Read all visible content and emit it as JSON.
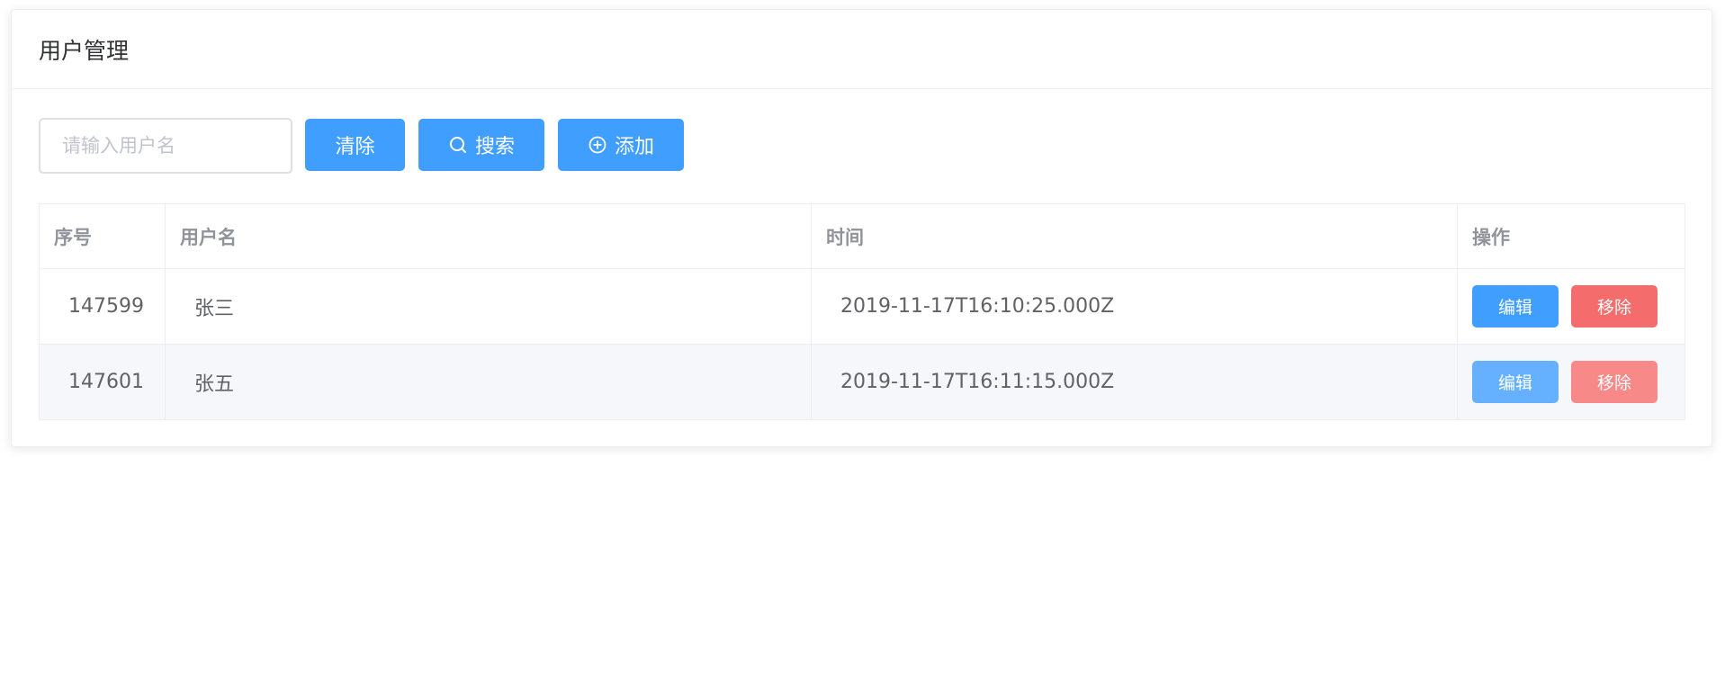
{
  "header": {
    "title": "用户管理"
  },
  "toolbar": {
    "search_placeholder": "请输入用户名",
    "clear_label": "清除",
    "search_label": "搜索",
    "add_label": "添加"
  },
  "table": {
    "columns": [
      "序号",
      "用户名",
      "时间",
      "操作"
    ],
    "rows": [
      {
        "id": "147599",
        "username": "张三",
        "time": "2019-11-17T16:10:25.000Z",
        "edit": "编辑",
        "remove": "移除"
      },
      {
        "id": "147601",
        "username": "张五",
        "time": "2019-11-17T16:11:15.000Z",
        "edit": "编辑",
        "remove": "移除"
      }
    ]
  },
  "colors": {
    "primary": "#409eff",
    "danger": "#f56c6c",
    "primary_hover": "#66b1ff",
    "danger_hover": "#f78989"
  }
}
